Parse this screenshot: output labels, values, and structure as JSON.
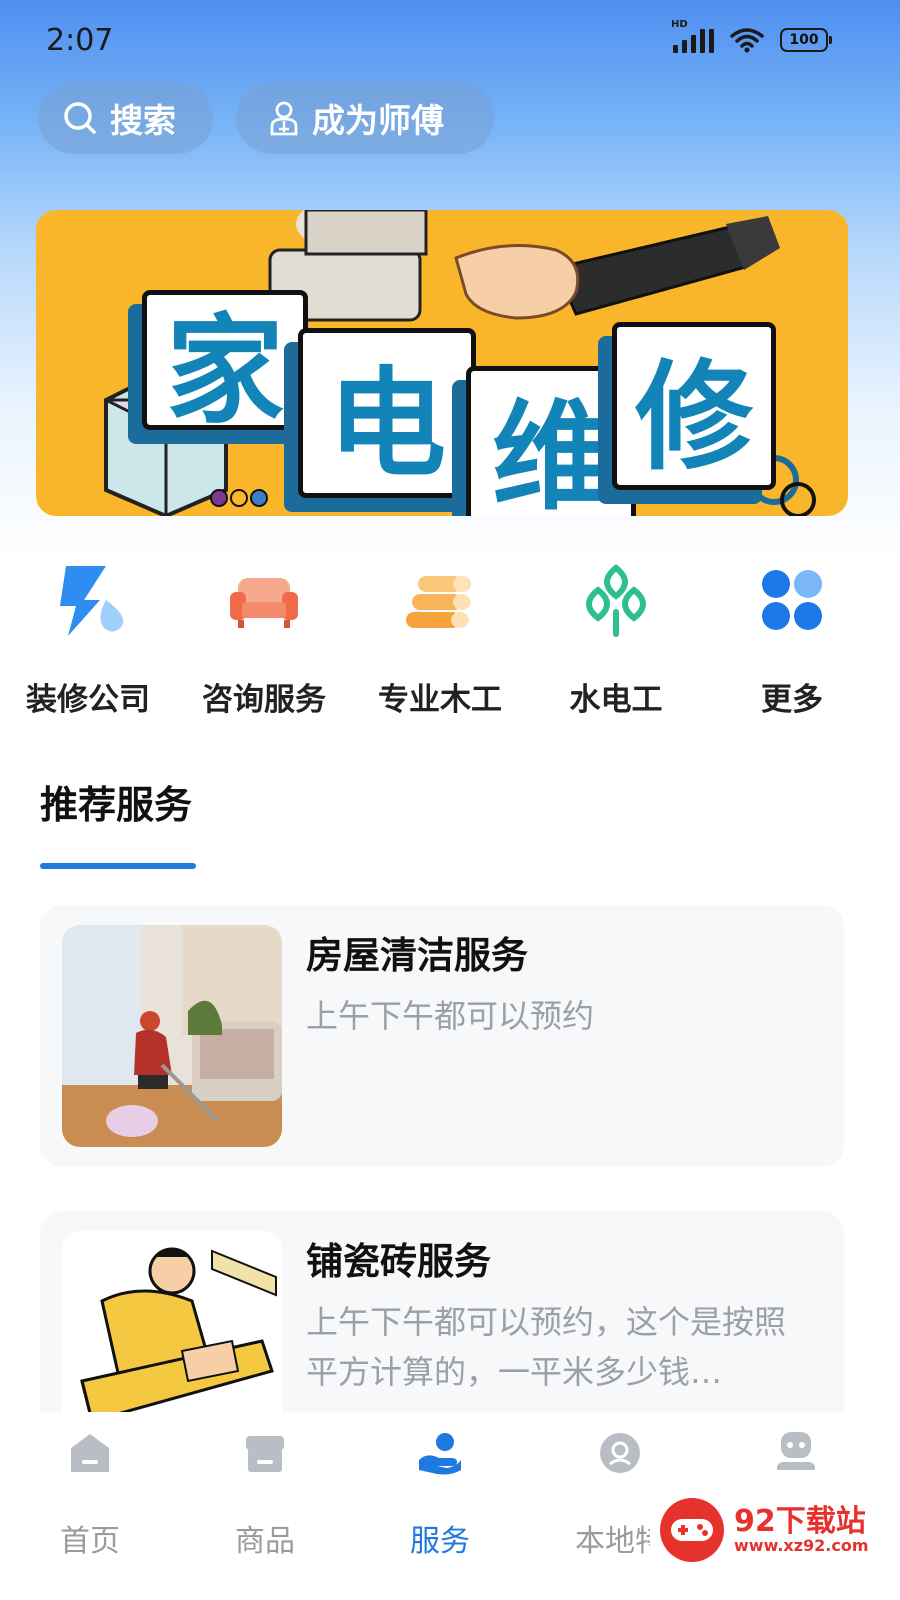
{
  "status_bar": {
    "time": "2:07",
    "hd_label": "HD",
    "battery": "100"
  },
  "header": {
    "search_label": "搜索",
    "become_master_label": "成为师傅"
  },
  "banner": {
    "tiles": [
      "家",
      "电",
      "维",
      "修"
    ]
  },
  "categories": [
    {
      "label": "装修公司",
      "icon": "renovation-icon"
    },
    {
      "label": "咨询服务",
      "icon": "sofa-icon"
    },
    {
      "label": "专业木工",
      "icon": "wood-logs-icon"
    },
    {
      "label": "水电工",
      "icon": "leaf-grid-icon"
    },
    {
      "label": "更多",
      "icon": "more-grid-icon"
    }
  ],
  "recommended": {
    "title": "推荐服务",
    "items": [
      {
        "title": "房屋清洁服务",
        "desc": "上午下午都可以预约"
      },
      {
        "title": "铺瓷砖服务",
        "desc": "上午下午都可以预约，这个是按照平方计算的，一平米多少钱…"
      }
    ]
  },
  "tabbar": {
    "tabs": [
      {
        "label": "首页",
        "icon": "home-icon"
      },
      {
        "label": "商品",
        "icon": "shop-icon"
      },
      {
        "label": "服务",
        "icon": "service-hand-icon"
      },
      {
        "label": "本地特",
        "icon": "local-badge-icon"
      },
      {
        "label": "",
        "icon": "profile-icon"
      }
    ],
    "active_index": 2
  },
  "watermark": {
    "title": "92下载站",
    "url": "www.xz92.com"
  },
  "colors": {
    "accent": "#1f7ae0",
    "banner_bg": "#f9b62a",
    "tile_text": "#1284b8"
  }
}
